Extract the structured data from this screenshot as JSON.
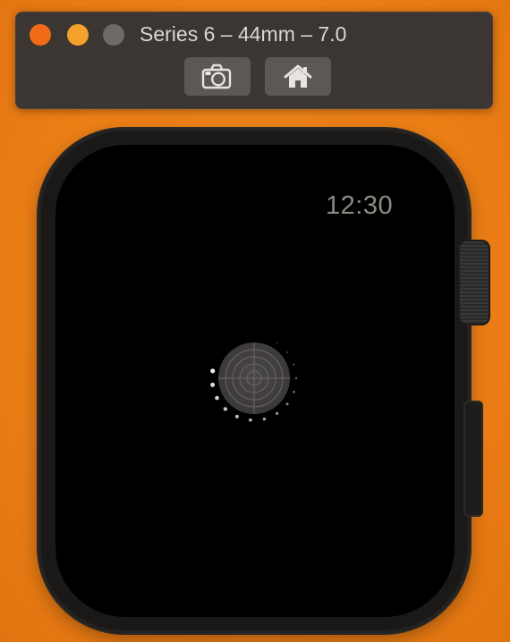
{
  "window": {
    "title": "Series 6 – 44mm – 7.0",
    "traffic_lights": [
      "close",
      "minimize",
      "zoom"
    ]
  },
  "toolbar": {
    "buttons": [
      {
        "name": "screenshot",
        "icon": "camera-icon"
      },
      {
        "name": "home",
        "icon": "home-icon"
      }
    ]
  },
  "watch": {
    "time": "12:30",
    "status": "loading",
    "loading_icon": "crosshair-loading-icon"
  },
  "colors": {
    "background": "#ee8017",
    "close": "#ef6b18",
    "minimize": "#f3a12a",
    "zoom": "#6e6a66",
    "clock_text": "#8e8a82"
  }
}
